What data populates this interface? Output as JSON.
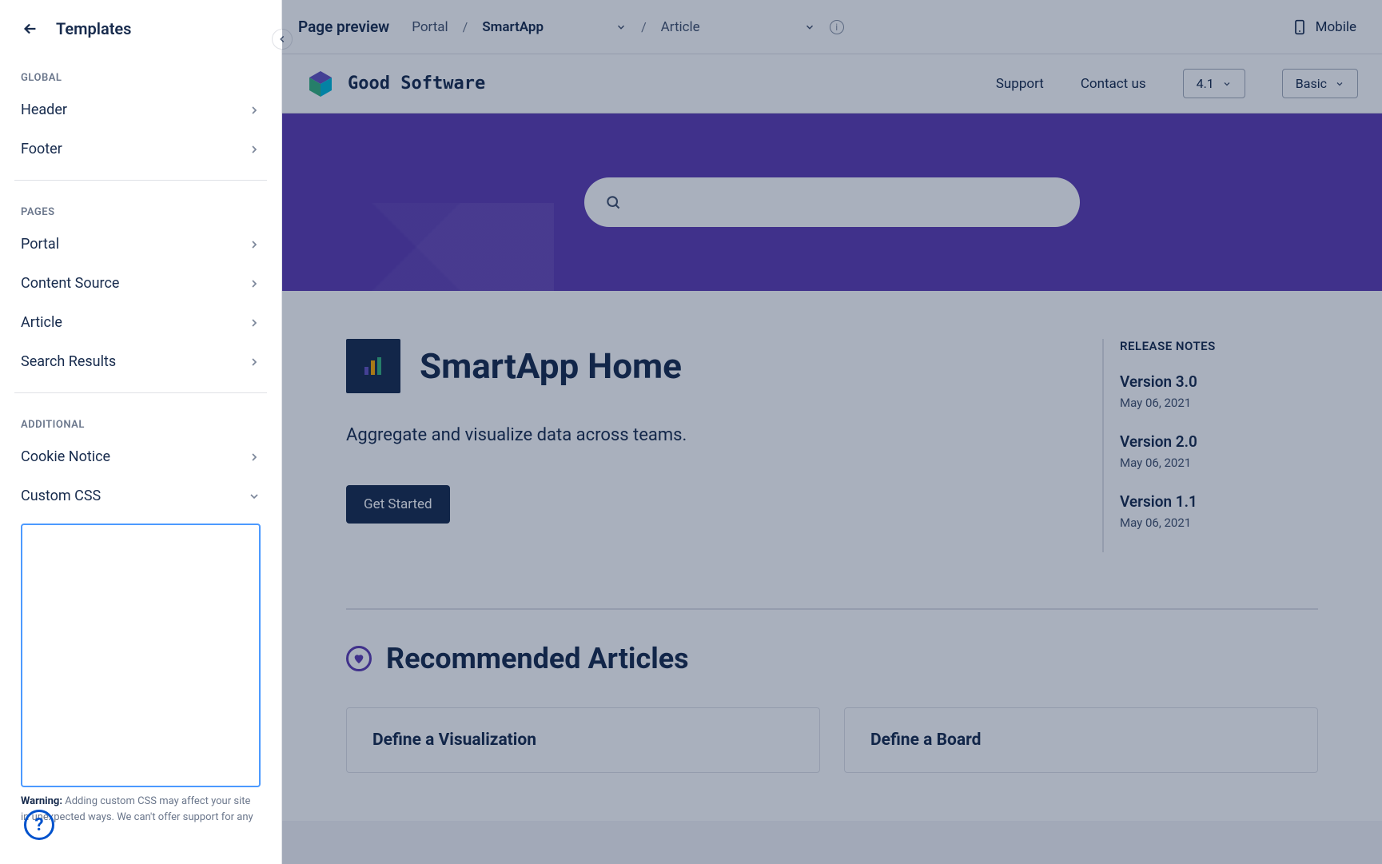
{
  "sidebar": {
    "title": "Templates",
    "sections": {
      "global": {
        "label": "GLOBAL",
        "items": [
          "Header",
          "Footer"
        ]
      },
      "pages": {
        "label": "PAGES",
        "items": [
          "Portal",
          "Content Source",
          "Article",
          "Search Results"
        ]
      },
      "additional": {
        "label": "ADDITIONAL",
        "items": [
          "Cookie Notice",
          "Custom CSS"
        ]
      }
    },
    "warning_label": "Warning:",
    "warning_text": " Adding custom CSS may affect your site in unexpected ways. We can't offer support for any"
  },
  "topbar": {
    "title": "Page preview",
    "crumb1": "Portal",
    "crumb2": "SmartApp",
    "crumb3": "Article",
    "mobile": "Mobile"
  },
  "site": {
    "brand": "Good Software",
    "links": [
      "Support",
      "Contact us"
    ],
    "version": "4.1",
    "tier": "Basic"
  },
  "page": {
    "title": "SmartApp Home",
    "subtitle": "Aggregate and visualize data across teams.",
    "cta": "Get Started"
  },
  "releases": {
    "heading": "RELEASE NOTES",
    "items": [
      {
        "ver": "Version 3.0",
        "date": "May 06, 2021"
      },
      {
        "ver": "Version 2.0",
        "date": "May 06, 2021"
      },
      {
        "ver": "Version 1.1",
        "date": "May 06, 2021"
      }
    ]
  },
  "recommended": {
    "heading": "Recommended Articles",
    "cards": [
      "Define a Visualization",
      "Define a Board"
    ]
  }
}
